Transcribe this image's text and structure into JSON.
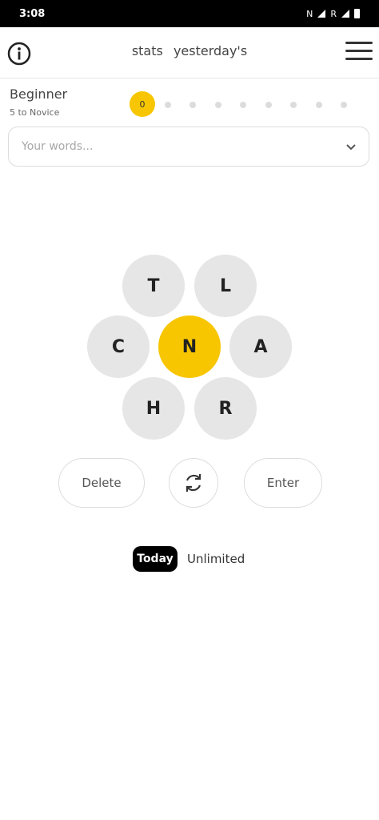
{
  "status_bar": {
    "time": "3:08",
    "indicators": [
      "N",
      "R"
    ]
  },
  "header": {
    "stats_link": "stats",
    "yesterday_link": "yesterday's"
  },
  "rank": {
    "name": "Beginner",
    "next": "5 to Novice",
    "score": "0",
    "progress_steps": 9,
    "current_step": 0,
    "accent_color": "#f7c600"
  },
  "words_input": {
    "placeholder": "Your words..."
  },
  "hive": {
    "center_letter": "N",
    "outer_letters": [
      "T",
      "L",
      "C",
      "A",
      "H",
      "R"
    ],
    "center_color": "#f7c600",
    "outer_color": "#e6e6e6"
  },
  "controls": {
    "delete_label": "Delete",
    "enter_label": "Enter",
    "shuffle_icon": "shuffle-icon"
  },
  "modes": {
    "today_label": "Today",
    "unlimited_label": "Unlimited",
    "selected": "Today"
  }
}
